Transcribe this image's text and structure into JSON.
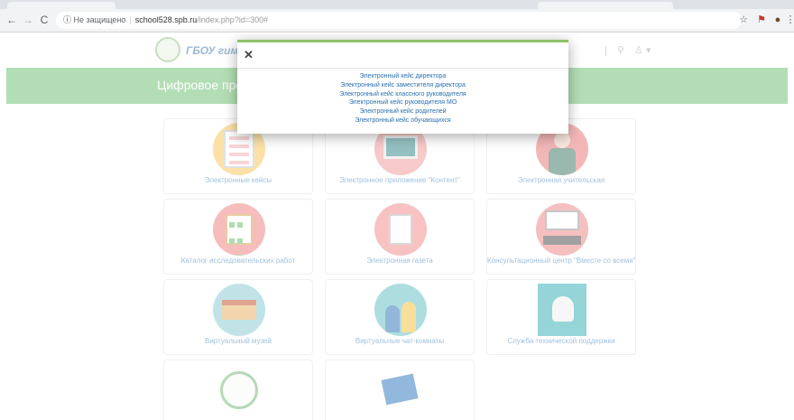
{
  "browser": {
    "security_label": "Не защищено",
    "url_host": "school528.spb.ru",
    "url_path": "/index.php?id=300#"
  },
  "site": {
    "brand": "ГБОУ гимна",
    "banner_title": "Цифровое прос"
  },
  "cards": [
    {
      "label": "Электронные кейсы"
    },
    {
      "label": "Электронное приложение \"Контент\""
    },
    {
      "label": "Электронная учительская"
    },
    {
      "label": "Каталог исследовательских работ"
    },
    {
      "label": "Электронная газета"
    },
    {
      "label": "Консультационный центр \"Вместе со всеми\""
    },
    {
      "label": "Виртуальный музей"
    },
    {
      "label": "Виртуальные чат-комнаты"
    },
    {
      "label": "Служба технической поддержки"
    },
    {
      "label": ""
    },
    {
      "label": ""
    }
  ],
  "modal": {
    "close_glyph": "✕",
    "links": [
      "Электронный кейс директора",
      "Электронный кейс заместителя директора",
      "Электронный кейс классного руководителя",
      "Электронный кейс руководителя МО",
      "Электронный кейс родителей",
      "Электронный кейс обучающихся"
    ]
  },
  "colors": {
    "banner": "#76c379",
    "link": "#2a6fb0",
    "modal_accent": "#8dc26a"
  }
}
